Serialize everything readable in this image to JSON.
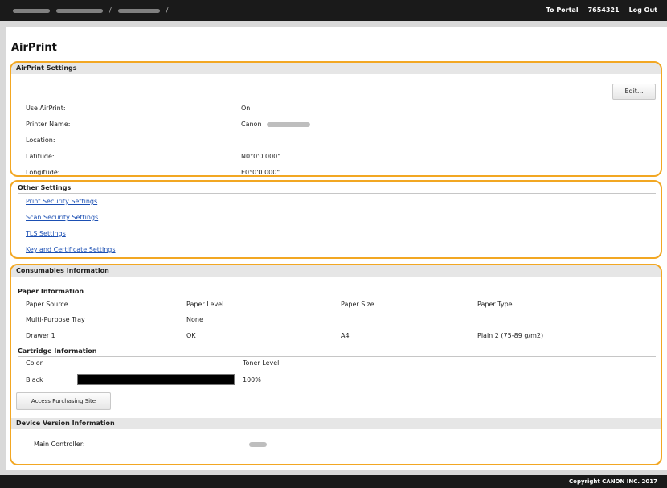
{
  "topbar": {
    "portal_label": "To Portal",
    "user_id": "7654321",
    "logout_label": "Log Out"
  },
  "page_title": "AirPrint",
  "airprint_settings": {
    "header": "AirPrint Settings",
    "edit_label": "Edit...",
    "rows": [
      {
        "label": "Use AirPrint:",
        "value": "On"
      },
      {
        "label": "Printer Name:",
        "value": "Canon"
      },
      {
        "label": "Location:",
        "value": ""
      },
      {
        "label": "Latitude:",
        "value": "N0°0'0.000\""
      },
      {
        "label": "Longitude:",
        "value": "E0°0'0.000\""
      }
    ]
  },
  "other_settings": {
    "header": "Other Settings",
    "links": [
      "Print Security Settings",
      "Scan Security Settings",
      "TLS Settings",
      "Key and Certificate Settings"
    ]
  },
  "consumables": {
    "header": "Consumables Information",
    "paper": {
      "header": "Paper Information",
      "columns": [
        "Paper Source",
        "Paper Level",
        "Paper Size",
        "Paper Type"
      ],
      "rows": [
        [
          "Multi-Purpose Tray",
          "None",
          "",
          ""
        ],
        [
          "Drawer 1",
          "OK",
          "A4",
          "Plain 2 (75-89 g/m2)"
        ]
      ]
    },
    "cartridge": {
      "header": "Cartridge Information",
      "col_color": "Color",
      "col_level": "Toner Level",
      "color": "Black",
      "level_text": "100%",
      "level_fraction": 1.0,
      "bar_color": "#000000"
    },
    "purchase_label": "Access Purchasing Site",
    "device": {
      "header": "Device Version Information",
      "main_label": "Main Controller:"
    }
  },
  "footer": {
    "copyright": "Copyright CANON INC. 2017"
  },
  "colors": {
    "accent_border": "#f2a723",
    "link": "#1b4fb3",
    "bar": "#1a1a1a"
  }
}
